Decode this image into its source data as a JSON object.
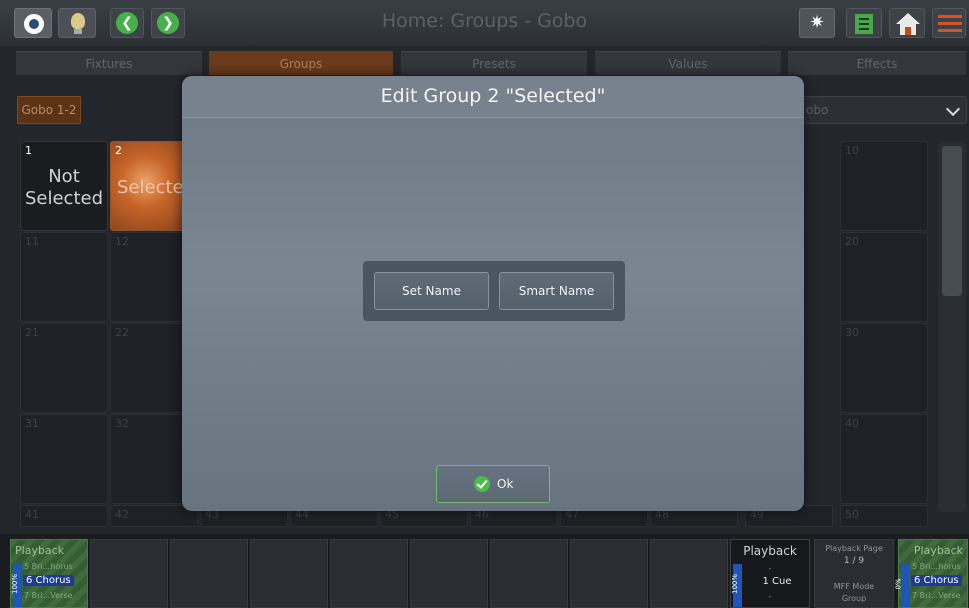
{
  "header": {
    "title": "Home: Groups - Gobo",
    "icons": [
      "eye-icon",
      "bulb-icon",
      "back-arrow-icon",
      "forward-arrow-icon",
      "magic-wand-icon",
      "grid-view-icon",
      "home-icon",
      "menu-icon"
    ]
  },
  "tabs": [
    {
      "label": "Fixtures"
    },
    {
      "label": "Groups",
      "active": true
    },
    {
      "label": "Presets"
    },
    {
      "label": "Values"
    },
    {
      "label": "Effects"
    }
  ],
  "subbar": {
    "group_button": "Gobo 1-2",
    "dropdown_value": "obo"
  },
  "groups": [
    {
      "num": "1",
      "name": "Not Selected"
    },
    {
      "num": "2",
      "name": "Selecte"
    },
    {
      "num": "10"
    },
    {
      "num": "11"
    },
    {
      "num": "12"
    },
    {
      "num": "20"
    },
    {
      "num": "21"
    },
    {
      "num": "22"
    },
    {
      "num": "30"
    },
    {
      "num": "31"
    },
    {
      "num": "32"
    },
    {
      "num": "40"
    },
    {
      "num": "41"
    },
    {
      "num": "42"
    },
    {
      "num": "43"
    },
    {
      "num": "44"
    },
    {
      "num": "45"
    },
    {
      "num": "46"
    },
    {
      "num": "47"
    },
    {
      "num": "48"
    },
    {
      "num": "49"
    },
    {
      "num": "50"
    }
  ],
  "playbacks": {
    "left": {
      "label": "Playback",
      "level": "100%",
      "line1": "5 Bri...horus",
      "line2": "6 Chorus",
      "line3": "7 Bri...Verse"
    },
    "middle": {
      "label": "Playback",
      "level": "100%",
      "line1": "-",
      "line2": "1 Cue",
      "line3": "-"
    },
    "page": {
      "label": "Playback Page",
      "value": "1 / 9",
      "mode": "MFF Mode",
      "mode_value": "Group"
    },
    "right": {
      "label": "Playback",
      "level": "0%",
      "line1": "5 Bri...horus",
      "line2": "6 Chorus",
      "line3": "7 Bri...Verse"
    }
  },
  "dialog": {
    "title": "Edit Group 2 \"Selected\"",
    "set_name": "Set Name",
    "smart_name": "Smart Name",
    "ok": "Ok"
  },
  "colors": {
    "accent_orange": "#6a3a1c",
    "success_green": "#4cbb4c",
    "dialog_bg": "#7a8592"
  }
}
